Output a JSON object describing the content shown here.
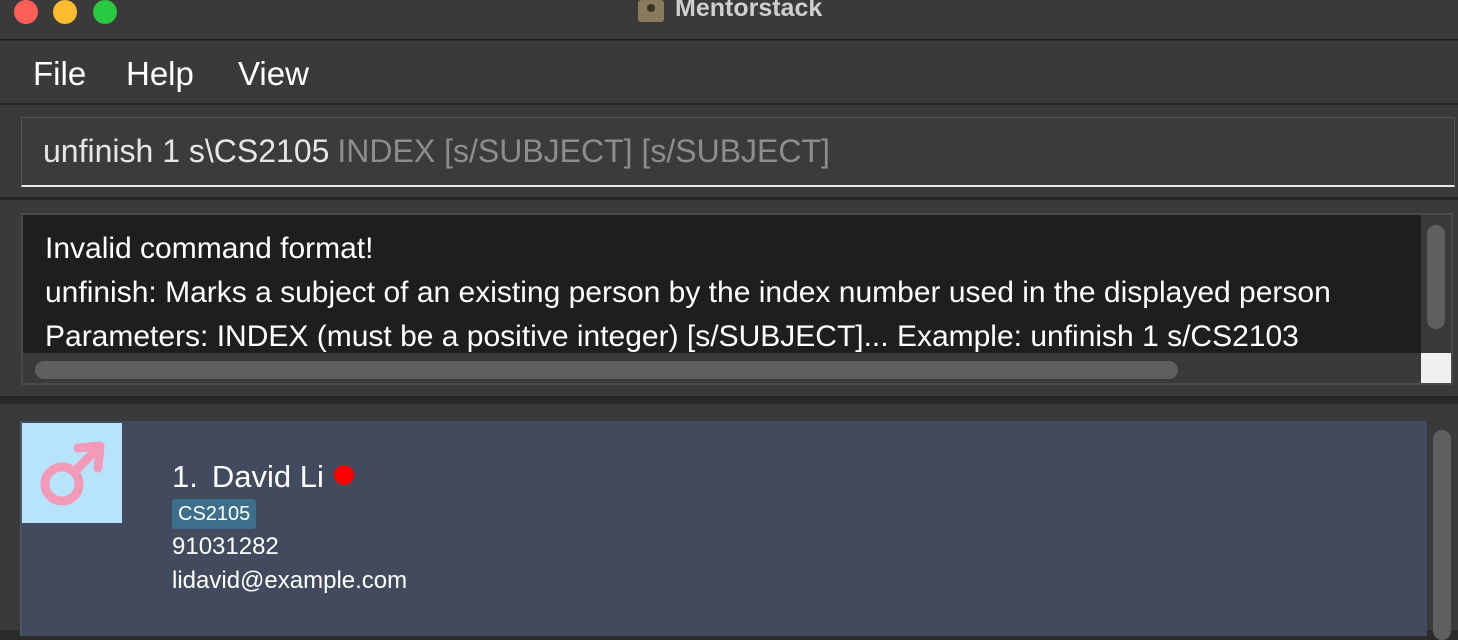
{
  "window": {
    "title": "Mentorstack"
  },
  "menu": {
    "items": [
      {
        "label": "File"
      },
      {
        "label": "Help"
      },
      {
        "label": "View"
      }
    ]
  },
  "command_box": {
    "value": "unfinish 1 s\\CS2105",
    "hint": "INDEX [s/SUBJECT] [s/SUBJECT]"
  },
  "result_display": {
    "lines": [
      "Invalid command format!",
      "unfinish: Marks a subject of an existing person by the index number used in the displayed person",
      "Parameters: INDEX (must be a positive integer) [s/SUBJECT]... Example: unfinish 1 s/CS2103"
    ]
  },
  "person_list": {
    "persons": [
      {
        "index": "1.",
        "name": "David Li",
        "gender_icon": "male-symbol-icon",
        "status_color": "#ff0000",
        "subjects": [
          "CS2105"
        ],
        "phone": "91031282",
        "email": "lidavid@example.com"
      }
    ]
  },
  "colors": {
    "background": "#2b2b2b",
    "card_background": "#414b5d",
    "tag_background": "#3d6e8a",
    "avatar_background": "#b8e4fb",
    "male_icon": "#f29ab7",
    "status_dot": "#ff0000"
  }
}
